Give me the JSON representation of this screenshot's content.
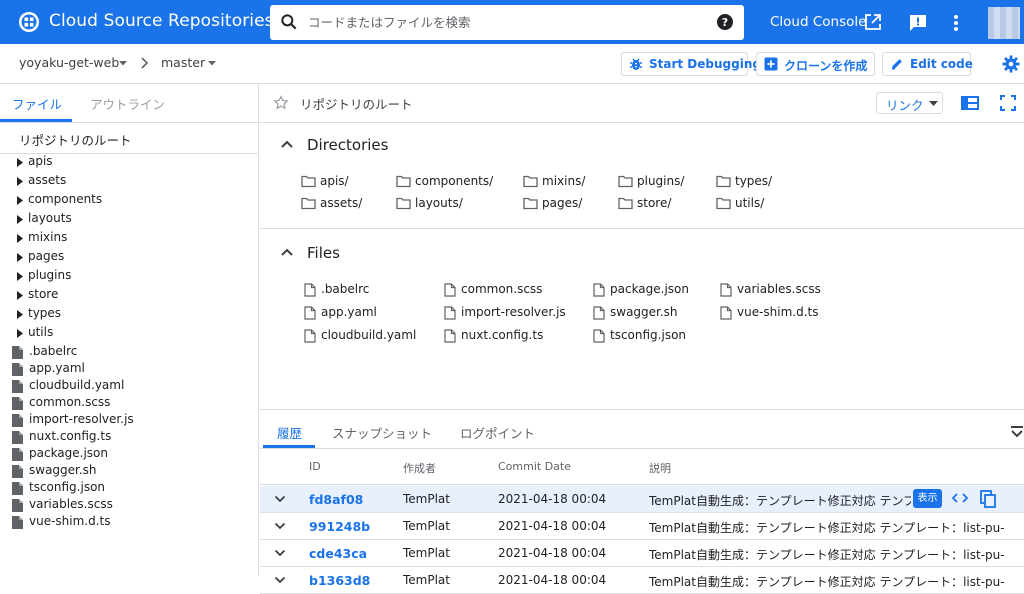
{
  "topbar": {
    "title": "Cloud Source Repositories",
    "search_placeholder": "コードまたはファイルを検索",
    "console_link": "Cloud Console"
  },
  "subbar": {
    "repo": "yoyaku-get-web",
    "branch": "master",
    "start_debugging": "Start Debugging",
    "clone": "クローンを作成",
    "edit_code": "Edit code"
  },
  "left": {
    "tab_files": "ファイル",
    "tab_outline": "アウトライン",
    "root_label": "リポジトリのルート",
    "folders": [
      "apis",
      "assets",
      "components",
      "layouts",
      "mixins",
      "pages",
      "plugins",
      "store",
      "types",
      "utils"
    ],
    "files": [
      ".babelrc",
      "app.yaml",
      "cloudbuild.yaml",
      "common.scss",
      "import-resolver.js",
      "nuxt.config.ts",
      "package.json",
      "swagger.sh",
      "tsconfig.json",
      "variables.scss",
      "vue-shim.d.ts"
    ]
  },
  "main": {
    "title": "リポジトリのルート",
    "link_button": "リンク",
    "directories_title": "Directories",
    "directories": [
      "apis/",
      "components/",
      "mixins/",
      "plugins/",
      "types/",
      "assets/",
      "layouts/",
      "pages/",
      "store/",
      "utils/"
    ],
    "files_title": "Files",
    "files": [
      ".babelrc",
      "common.scss",
      "package.json",
      "variables.scss",
      "app.yaml",
      "import-resolver.js",
      "swagger.sh",
      "vue-shim.d.ts",
      "cloudbuild.yaml",
      "nuxt.config.ts",
      "tsconfig.json"
    ]
  },
  "history": {
    "tabs": [
      "履歴",
      "スナップショット",
      "ログポイント"
    ],
    "columns": [
      "ID",
      "作成者",
      "Commit Date",
      "説明"
    ],
    "show_button": "表示",
    "rows": [
      {
        "id": "fd8af08",
        "author": "TemPlat",
        "date": "2021-04-18 00:04",
        "message": "TemPlat自動生成：テンプレート修正対応 テンプレート：list-pu-"
      },
      {
        "id": "991248b",
        "author": "TemPlat",
        "date": "2021-04-18 00:04",
        "message": "TemPlat自動生成：テンプレート修正対応 テンプレート：list-pu-"
      },
      {
        "id": "cde43ca",
        "author": "TemPlat",
        "date": "2021-04-18 00:04",
        "message": "TemPlat自動生成：テンプレート修正対応 テンプレート：list-pu-"
      },
      {
        "id": "b1363d8",
        "author": "TemPlat",
        "date": "2021-04-18 00:04",
        "message": "TemPlat自動生成：テンプレート修正対応 テンプレート：list-pu-"
      }
    ]
  },
  "colors": {
    "accent": "#1a73e8",
    "selected_row": "#e8f0fe",
    "border": "#dadce0"
  }
}
